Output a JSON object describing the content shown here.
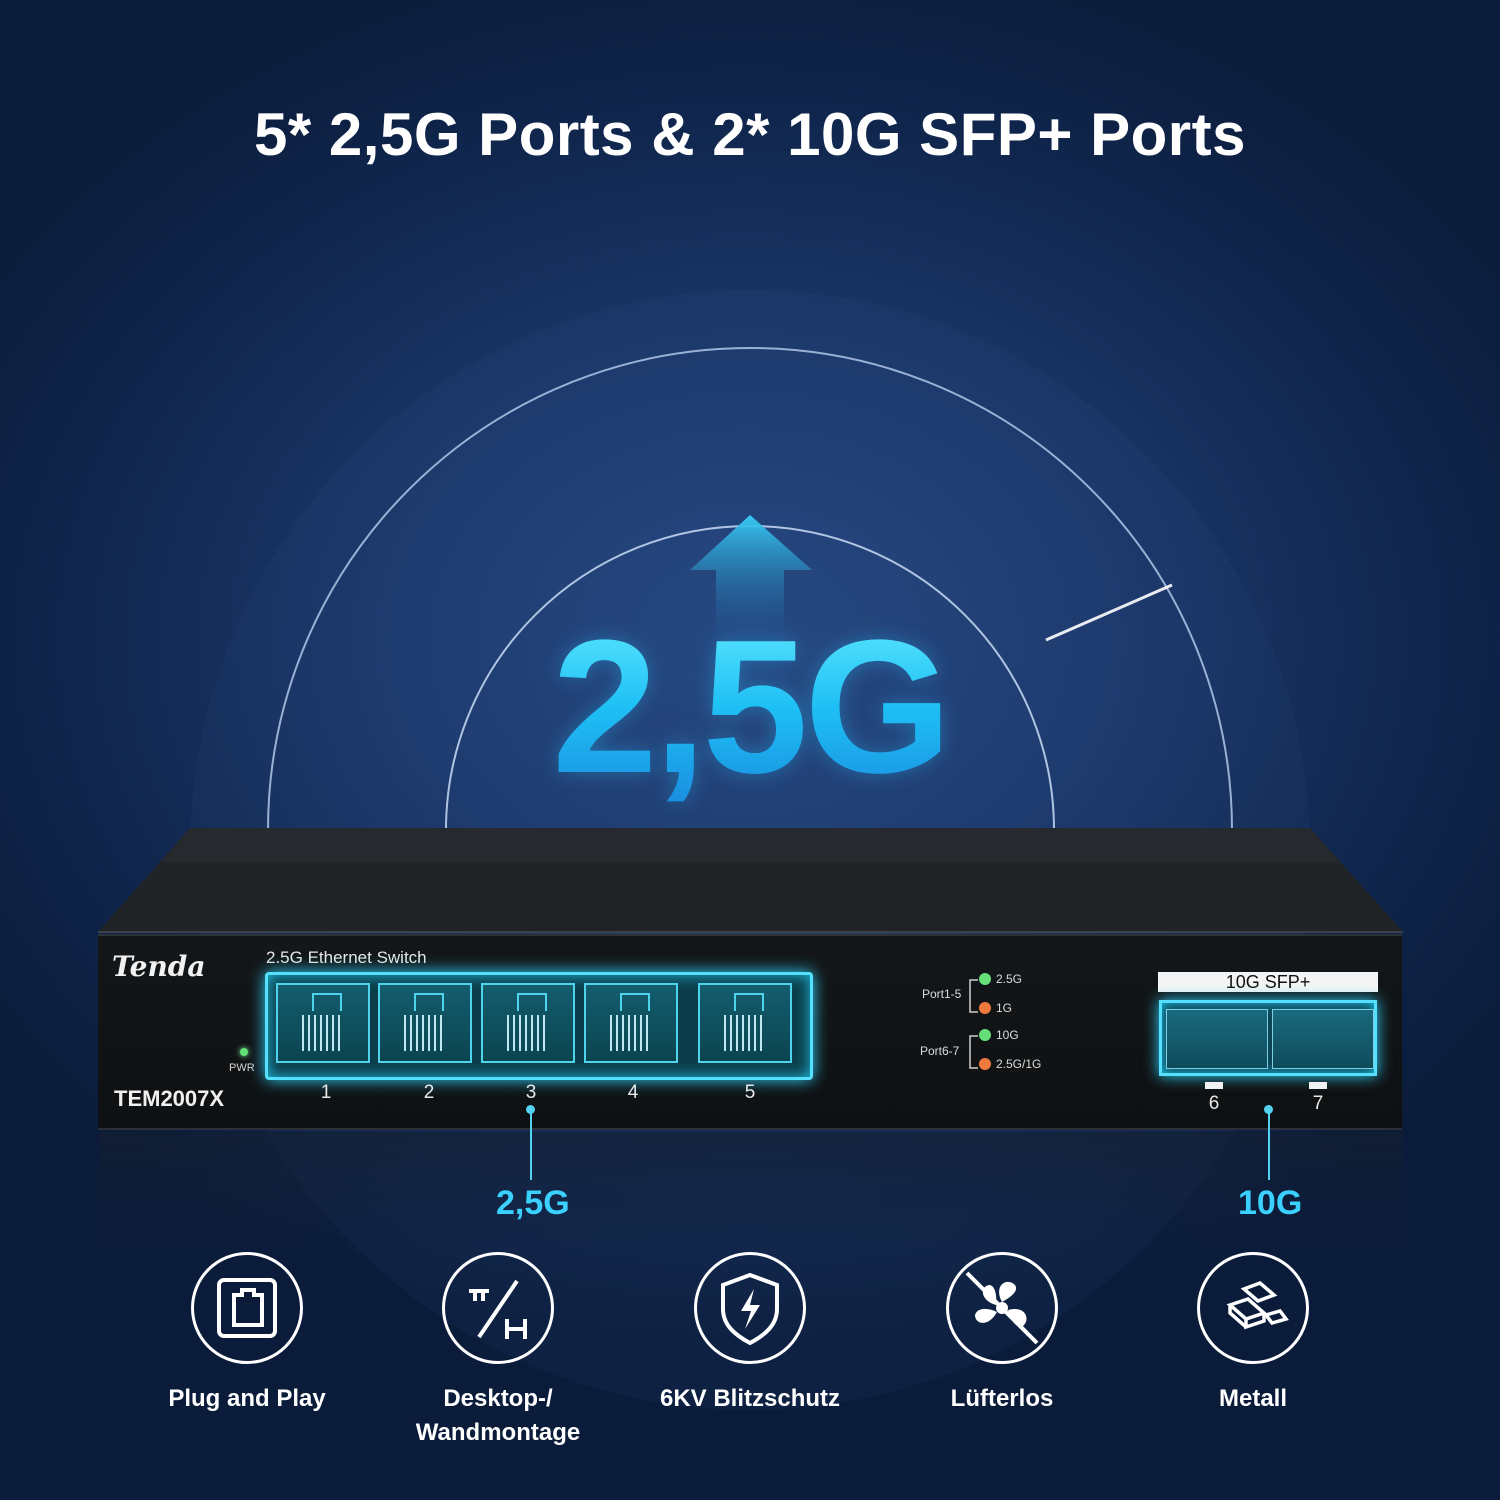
{
  "headline": "5* 2,5G Ports & 2* 10G SFP+ Ports",
  "hero_speed": "2,5G",
  "device": {
    "brand": "Tenda",
    "subtitle": "2.5G Ethernet Switch",
    "model": "TEM2007X",
    "pwr_label": "PWR",
    "ports_rj45": [
      "1",
      "2",
      "3",
      "4",
      "5"
    ],
    "legend": {
      "group1_label": "Port1-5",
      "group1_a": "2.5G",
      "group1_b": "1G",
      "group2_label": "Port6-7",
      "group2_a": "10G",
      "group2_b": "2.5G/1G"
    },
    "sfp_label": "10G SFP+",
    "ports_sfp": [
      "6",
      "7"
    ]
  },
  "callouts": {
    "rj45_speed": "2,5G",
    "sfp_speed": "10G"
  },
  "features": [
    {
      "label": "Plug and Play",
      "icon": "plug-and-play-icon"
    },
    {
      "label_line1": "Desktop-/",
      "label_line2": "Wandmontage",
      "icon": "mounting-icon"
    },
    {
      "label": "6KV Blitzschutz",
      "icon": "lightning-shield-icon"
    },
    {
      "label": "Lüfterlos",
      "icon": "fanless-icon"
    },
    {
      "label": "Metall",
      "icon": "metal-bars-icon"
    }
  ],
  "colors": {
    "background": "#1b386b",
    "accent_cyan": "#3ad0ff",
    "led_green": "#65e079",
    "led_orange": "#f07a3c"
  }
}
